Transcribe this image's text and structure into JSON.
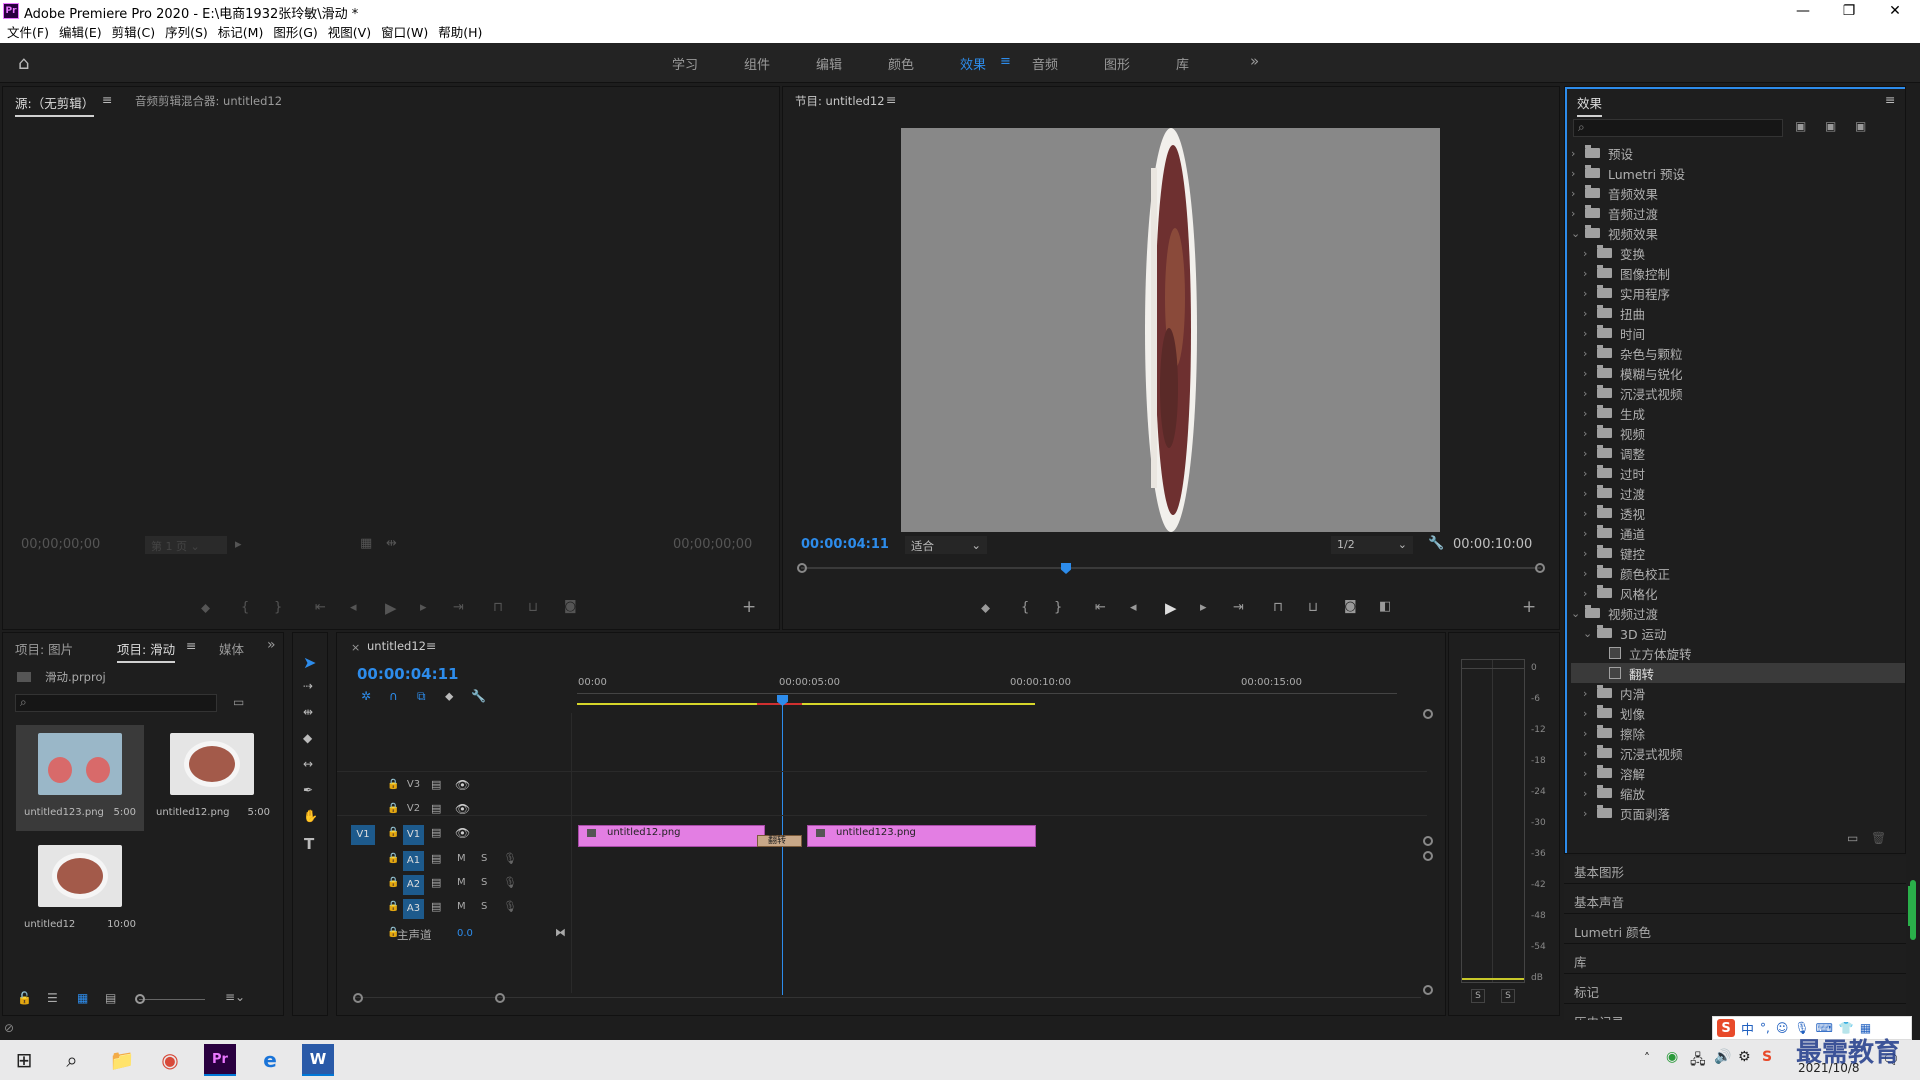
{
  "window": {
    "title": "Adobe Premiere Pro 2020 - E:\\电商1932张玲敏\\滑动 *",
    "icon_text": "Pr"
  },
  "menu": [
    "文件(F)",
    "编辑(E)",
    "剪辑(C)",
    "序列(S)",
    "标记(M)",
    "图形(G)",
    "视图(V)",
    "窗口(W)",
    "帮助(H)"
  ],
  "workspaces": [
    "学习",
    "组件",
    "编辑",
    "颜色",
    "效果",
    "音频",
    "图形",
    "库"
  ],
  "source_panel": {
    "tab_source": "源:（无剪辑）",
    "tab_mixer": "音频剪辑混合器: untitled12",
    "timecode_left": "00;00;00;00",
    "timecode_right": "00;00;00;00",
    "page_select": "第 1 页"
  },
  "program_panel": {
    "tab": "节目: untitled12",
    "timecode": "00:00:04:11",
    "fit": "适合",
    "resolution": "1/2",
    "duration": "00:00:10:00"
  },
  "project_panel": {
    "tabs": [
      "项目: 图片",
      "项目: 滑动",
      "媒体"
    ],
    "file": "滑动.prproj",
    "items": [
      {
        "name": "untitled123.png",
        "duration": "5:00"
      },
      {
        "name": "untitled12.png",
        "duration": "5:00"
      },
      {
        "name": "untitled12",
        "duration": "10:00"
      }
    ]
  },
  "timeline": {
    "tab": "untitled12",
    "timecode": "00:00:04:11",
    "ruler": [
      "00:00",
      "00:00:05:00",
      "00:00:10:00",
      "00:00:15:00"
    ],
    "tracks": {
      "video": [
        "V3",
        "V2",
        "V1"
      ],
      "audio": [
        "A1",
        "A2",
        "A3"
      ],
      "master": "主声道",
      "master_value": "0.0",
      "source_patch": "V1",
      "m": "M",
      "s": "S"
    },
    "clips": [
      {
        "name": "untitled12.png"
      },
      {
        "name": "untitled123.png"
      }
    ],
    "transition": "翻转"
  },
  "meter": {
    "scale": [
      "0",
      "-6",
      "-12",
      "-18",
      "-24",
      "-30",
      "-36",
      "-42",
      "-48",
      "-54",
      "dB"
    ],
    "solo": [
      "S",
      "S"
    ]
  },
  "effects_panel": {
    "title": "效果",
    "search_placeholder": "",
    "tree": [
      {
        "label": "预设",
        "level": 0,
        "open": false,
        "type": "preset"
      },
      {
        "label": "Lumetri 预设",
        "level": 0,
        "open": false,
        "type": "preset"
      },
      {
        "label": "音频效果",
        "level": 0,
        "open": false,
        "type": "folder"
      },
      {
        "label": "音频过渡",
        "level": 0,
        "open": false,
        "type": "folder"
      },
      {
        "label": "视频效果",
        "level": 0,
        "open": true,
        "type": "folder"
      },
      {
        "label": "变换",
        "level": 1,
        "open": false,
        "type": "folder"
      },
      {
        "label": "图像控制",
        "level": 1,
        "open": false,
        "type": "folder"
      },
      {
        "label": "实用程序",
        "level": 1,
        "open": false,
        "type": "folder"
      },
      {
        "label": "扭曲",
        "level": 1,
        "open": false,
        "type": "folder"
      },
      {
        "label": "时间",
        "level": 1,
        "open": false,
        "type": "folder"
      },
      {
        "label": "杂色与颗粒",
        "level": 1,
        "open": false,
        "type": "folder"
      },
      {
        "label": "模糊与锐化",
        "level": 1,
        "open": false,
        "type": "folder"
      },
      {
        "label": "沉浸式视频",
        "level": 1,
        "open": false,
        "type": "folder"
      },
      {
        "label": "生成",
        "level": 1,
        "open": false,
        "type": "folder"
      },
      {
        "label": "视频",
        "level": 1,
        "open": false,
        "type": "folder"
      },
      {
        "label": "调整",
        "level": 1,
        "open": false,
        "type": "folder"
      },
      {
        "label": "过时",
        "level": 1,
        "open": false,
        "type": "folder"
      },
      {
        "label": "过渡",
        "level": 1,
        "open": false,
        "type": "folder"
      },
      {
        "label": "透视",
        "level": 1,
        "open": false,
        "type": "folder"
      },
      {
        "label": "通道",
        "level": 1,
        "open": false,
        "type": "folder"
      },
      {
        "label": "键控",
        "level": 1,
        "open": false,
        "type": "folder"
      },
      {
        "label": "颜色校正",
        "level": 1,
        "open": false,
        "type": "folder"
      },
      {
        "label": "风格化",
        "level": 1,
        "open": false,
        "type": "folder"
      },
      {
        "label": "视频过渡",
        "level": 0,
        "open": true,
        "type": "folder"
      },
      {
        "label": "3D 运动",
        "level": 1,
        "open": true,
        "type": "folder"
      },
      {
        "label": "立方体旋转",
        "level": 2,
        "open": false,
        "type": "effect"
      },
      {
        "label": "翻转",
        "level": 2,
        "open": false,
        "type": "effect",
        "selected": true
      },
      {
        "label": "内滑",
        "level": 1,
        "open": false,
        "type": "folder"
      },
      {
        "label": "划像",
        "level": 1,
        "open": false,
        "type": "folder"
      },
      {
        "label": "擦除",
        "level": 1,
        "open": false,
        "type": "folder"
      },
      {
        "label": "沉浸式视频",
        "level": 1,
        "open": false,
        "type": "folder"
      },
      {
        "label": "溶解",
        "level": 1,
        "open": false,
        "type": "folder"
      },
      {
        "label": "缩放",
        "level": 1,
        "open": false,
        "type": "folder"
      },
      {
        "label": "页面剥落",
        "level": 1,
        "open": false,
        "type": "folder"
      }
    ],
    "collapsed_panels": [
      "基本图形",
      "基本声音",
      "Lumetri 颜色",
      "库",
      "标记",
      "历史记录"
    ]
  },
  "taskbar": {
    "date": "2021/10/8",
    "ime": "中",
    "watermark": "最需教育"
  },
  "colors": {
    "accent": "#2d8ceb",
    "clip": "#e37ee3",
    "bg": "#1d1d1d"
  }
}
